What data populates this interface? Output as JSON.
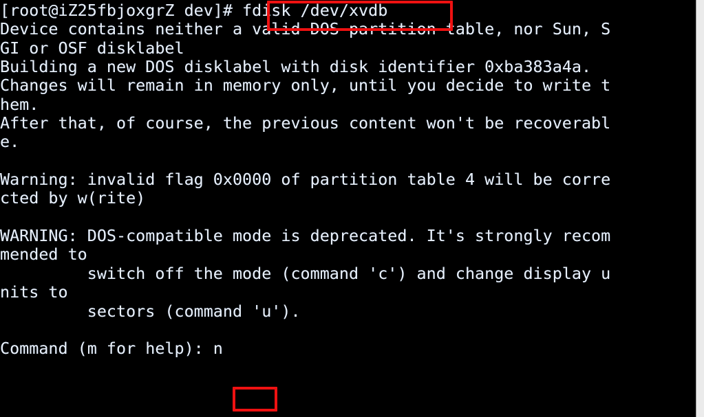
{
  "terminal": {
    "background_color": "#000000",
    "text_color": "#e8eef6",
    "annotation_color": "#ee1111",
    "prompt": "[root@iZ25fbjoxgrZ dev]#",
    "hostname": "iZ25fbjoxgrZ",
    "user": "root",
    "cwd": "dev",
    "command": "fdisk /dev/xvdb",
    "disk_identifier": "0xba383a4a",
    "device": "/dev/xvdb",
    "fdisk_command_input": "n",
    "fdisk_prompt": "Command (m for help):",
    "lines": [
      "[root@iZ25fbjoxgrZ dev]# fdisk /dev/xvdb",
      "Device contains neither a valid DOS partition table, nor Sun, S",
      "GI or OSF disklabel",
      "Building a new DOS disklabel with disk identifier 0xba383a4a.",
      "Changes will remain in memory only, until you decide to write t",
      "hem.",
      "After that, of course, the previous content won't be recoverabl",
      "e.",
      "",
      "Warning: invalid flag 0x0000 of partition table 4 will be corre",
      "cted by w(rite)",
      "",
      "WARNING: DOS-compatible mode is deprecated. It's strongly recom",
      "mended to",
      "         switch off the mode (command 'c') and change display u",
      "nits to",
      "         sectors (command 'u').",
      "",
      "Command (m for help): n"
    ]
  },
  "annotations": [
    {
      "name": "annotation-command",
      "target_text": "fdisk /dev/xvdb",
      "color": "#ee1111"
    },
    {
      "name": "annotation-response",
      "target_text": "n",
      "color": "#ee1111"
    }
  ],
  "scrollbar": {
    "track_color": "#ebebeb",
    "orientation": "vertical"
  }
}
